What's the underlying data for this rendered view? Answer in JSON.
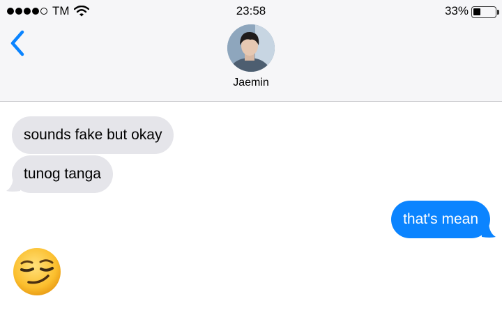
{
  "status_bar": {
    "carrier": "TM",
    "time": "23:58",
    "battery_percent_label": "33%",
    "battery_level": 0.33,
    "signal_bars_filled": 4,
    "signal_bars_total": 5
  },
  "header": {
    "contact_name": "Jaemin",
    "back_icon": "chevron-left-icon",
    "avatar": "contact-avatar"
  },
  "messages": [
    {
      "direction": "incoming",
      "text": "sounds fake but okay"
    },
    {
      "direction": "incoming",
      "text": "tunog tanga"
    },
    {
      "direction": "outgoing",
      "text": "that's mean"
    },
    {
      "direction": "incoming",
      "type": "emoji",
      "icon": "smirking-face-emoji"
    }
  ],
  "colors": {
    "outgoing_bubble": "#0b84ff",
    "incoming_bubble": "#e5e5ea",
    "accent": "#0b84ff",
    "header_background": "#f6f6f8"
  }
}
